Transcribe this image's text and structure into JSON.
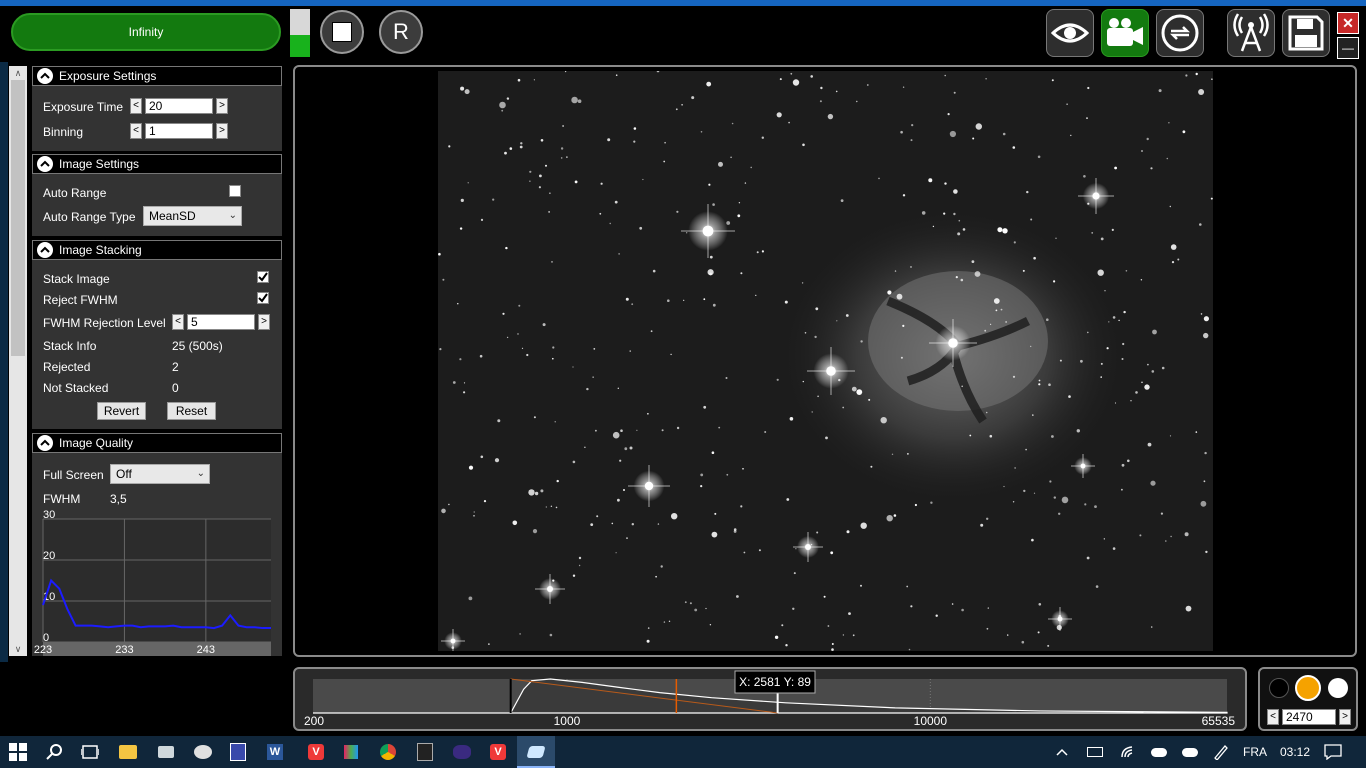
{
  "toolbar": {
    "run_label": "Infinity",
    "level_fraction": 0.45,
    "stop_icon": "stop-icon",
    "reset_label": "R",
    "buttons": [
      "eye-icon",
      "video-camera-icon",
      "loop-icon",
      "antenna-icon",
      "save-icon"
    ],
    "close_label": "✕",
    "minimize_label": "—"
  },
  "exposure": {
    "title": "Exposure Settings",
    "exposure_time_label": "Exposure Time",
    "exposure_time_value": "20",
    "binning_label": "Binning",
    "binning_value": "1"
  },
  "image_settings": {
    "title": "Image Settings",
    "auto_range_label": "Auto Range",
    "auto_range_checked": false,
    "auto_range_type_label": "Auto Range Type",
    "auto_range_type_value": "MeanSD"
  },
  "stacking": {
    "title": "Image Stacking",
    "stack_image_label": "Stack Image",
    "stack_image_checked": true,
    "reject_fwhm_label": "Reject FWHM",
    "reject_fwhm_checked": true,
    "rejection_level_label": "FWHM Rejection Level",
    "rejection_level_value": "5",
    "stack_info_label": "Stack Info",
    "stack_info_value": "25 (500s)",
    "rejected_label": "Rejected",
    "rejected_value": "2",
    "not_stacked_label": "Not Stacked",
    "not_stacked_value": "0",
    "revert_label": "Revert",
    "reset_label": "Reset"
  },
  "quality": {
    "title": "Image Quality",
    "full_screen_label": "Full Screen",
    "full_screen_value": "Off",
    "fwhm_label": "FWHM",
    "fwhm_value": "3,5"
  },
  "chart_data": [
    {
      "type": "line",
      "title": "",
      "xlabel": "",
      "ylabel": "",
      "xticks": [
        "223",
        "233",
        "243"
      ],
      "yticks": [
        "0",
        "10",
        "20",
        "30"
      ],
      "ylim": [
        0,
        30
      ],
      "xlim": [
        223,
        251
      ],
      "grid": true,
      "series": [
        {
          "color": "#1c1cff",
          "x": [
            223,
            224,
            225,
            226,
            227,
            228,
            229,
            230,
            231,
            232,
            233,
            234,
            235,
            236,
            237,
            238,
            239,
            240,
            241,
            242,
            243,
            244,
            245,
            246,
            247,
            248,
            249,
            250,
            251
          ],
          "y": [
            9,
            15,
            13,
            8,
            4,
            4,
            4,
            3.8,
            3.6,
            3.8,
            4,
            4,
            3.6,
            3.8,
            3.8,
            3.8,
            4,
            3.6,
            3.6,
            3.6,
            3.6,
            3.4,
            4,
            6.5,
            4,
            3.6,
            3.6,
            3.4,
            3.4
          ]
        }
      ]
    },
    {
      "type": "area",
      "title": "",
      "xscale": "log",
      "xticks": [
        "200",
        "1000",
        "10000",
        "65535"
      ],
      "xlim": [
        200,
        65535
      ],
      "annotation": "X: 2581 Y: 89",
      "black_point": 700,
      "white_point": 3800,
      "marker": 2000,
      "series": [
        {
          "color": "#ffffff",
          "x": [
            200,
            700,
            760,
            800,
            900,
            1100,
            1400,
            1800,
            2500,
            4000,
            8000,
            20000,
            65535
          ],
          "y": [
            0,
            0,
            70,
            95,
            100,
            90,
            75,
            60,
            45,
            30,
            15,
            6,
            2
          ]
        }
      ]
    }
  ],
  "stretch": {
    "colors": [
      "#000000",
      "#f5a200",
      "#ffffff"
    ],
    "selected_index": 1,
    "value": "2470"
  },
  "taskbar": {
    "apps": [
      "start-icon",
      "search-icon",
      "task-view-icon",
      "explorer-icon",
      "app-icon",
      "app-icon",
      "app-icon",
      "word-icon",
      "vivaldi-icon",
      "app-icon",
      "chrome-icon",
      "app-icon",
      "app-icon",
      "vivaldi-icon",
      "sharpcap-icon"
    ],
    "language": "FRA",
    "time": "03:12"
  }
}
